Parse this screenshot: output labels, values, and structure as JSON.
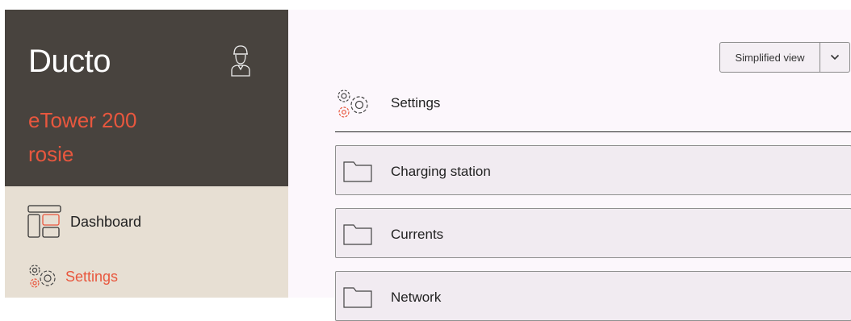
{
  "app": {
    "name": "Ducto"
  },
  "device": {
    "line1": "eTower 200",
    "line2": "rosie"
  },
  "nav": {
    "items": [
      {
        "label": "Dashboard"
      },
      {
        "label": "Settings"
      }
    ]
  },
  "view_selector": {
    "selected": "Simplified view"
  },
  "section": {
    "title": "Settings"
  },
  "folders": [
    {
      "label": "Charging station"
    },
    {
      "label": "Currents"
    },
    {
      "label": "Network"
    }
  ],
  "colors": {
    "accent": "#e8573e",
    "header_bg": "#48433e",
    "nav_bg": "#e7dfd3",
    "main_bg": "#fcf7fc"
  }
}
